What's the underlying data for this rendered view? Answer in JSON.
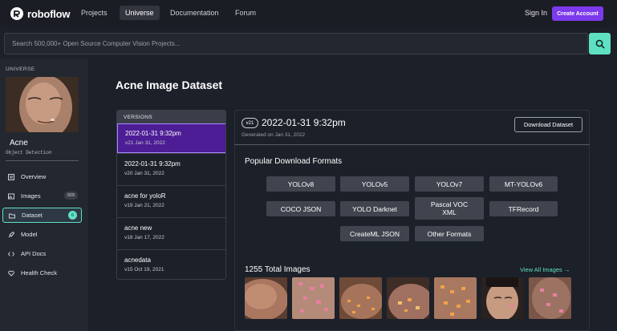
{
  "nav": {
    "brand": "roboflow",
    "links": [
      "Projects",
      "Universe",
      "Documentation",
      "Forum"
    ],
    "active": "Universe",
    "signin": "Sign In",
    "create_account": "Create Account"
  },
  "search": {
    "placeholder": "Search 500,000+ Open Source Computer Vision Projects..."
  },
  "sidebar": {
    "section_label": "UNIVERSE",
    "project_name": "Acne",
    "project_type": "Object Detection",
    "items": [
      {
        "label": "Overview",
        "icon": "list-icon"
      },
      {
        "label": "Images",
        "icon": "image-icon",
        "badge": "929"
      },
      {
        "label": "Dataset",
        "icon": "folder-icon",
        "badge": "6"
      },
      {
        "label": "Model",
        "icon": "rocket-icon"
      },
      {
        "label": "API Docs",
        "icon": "code-icon"
      },
      {
        "label": "Health Check",
        "icon": "heart-icon"
      }
    ]
  },
  "main": {
    "title": "Acne Image Dataset",
    "versions_header": "VERSIONS",
    "versions": [
      {
        "name": "2022-01-31 9:32pm",
        "meta": "v21 Jan 31, 2022"
      },
      {
        "name": "2022-01-31 9:32pm",
        "meta": "v20 Jan 31, 2022"
      },
      {
        "name": "acne for yoloR",
        "meta": "v19 Jan 21, 2022"
      },
      {
        "name": "acne new",
        "meta": "v18 Jan 17, 2022"
      },
      {
        "name": "acnedata",
        "meta": "v15 Oct 19, 2021"
      }
    ],
    "panel": {
      "version_badge": "v21",
      "title": "2022-01-31 9:32pm",
      "subtitle": "Generated on Jan 31, 2022",
      "download_button": "Download Dataset",
      "formats_title": "Popular Download Formats",
      "formats": [
        "YOLOv8",
        "YOLOv5",
        "YOLOv7",
        "MT-YOLOv6",
        "COCO JSON",
        "YOLO Darknet",
        "Pascal VOC XML",
        "TFRecord",
        "CreateML JSON",
        "Other Formats"
      ],
      "total_count": "1255",
      "total_label": "Total Images",
      "view_all": "View All Images →"
    }
  },
  "colors": {
    "accent": "#5fe0c3",
    "brand_purple": "#7c3aed",
    "version_active": "#4c1d95"
  }
}
